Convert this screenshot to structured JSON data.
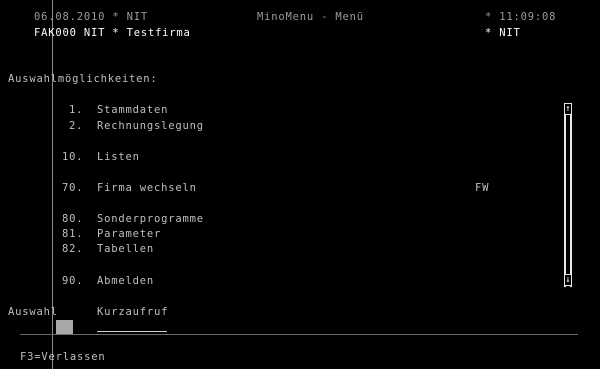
{
  "header": {
    "date_line": "06.08.2010 * NIT",
    "title": "MinoMenu - Menü",
    "time": "* 11:09:08",
    "company_line": "FAK000 NIT * Testfirma",
    "user": "* NIT"
  },
  "section_title": "Auswahlmöglichkeiten:",
  "menu": [
    {
      "num": "1.",
      "label": "Stammdaten",
      "shortcut": ""
    },
    {
      "num": "2.",
      "label": "Rechnungslegung",
      "shortcut": ""
    },
    {
      "num": "10.",
      "label": "Listen",
      "shortcut": ""
    },
    {
      "num": "70.",
      "label": "Firma wechseln",
      "shortcut": "FW"
    },
    {
      "num": "80.",
      "label": "Sonderprogramme",
      "shortcut": ""
    },
    {
      "num": "81.",
      "label": "Parameter",
      "shortcut": ""
    },
    {
      "num": "82.",
      "label": "Tabellen",
      "shortcut": ""
    },
    {
      "num": "90.",
      "label": "Abmelden",
      "shortcut": ""
    }
  ],
  "input": {
    "selection_label": "Auswahl",
    "shortcut_label": "Kurzaufruf",
    "selection_value": "",
    "shortcut_value": ""
  },
  "scrollbar": {
    "up_glyph": "↑",
    "down_glyph": "↓",
    "up_icon": "arrow-up-icon",
    "down_icon": "arrow-down-icon"
  },
  "footer": {
    "function_keys": "F3=Verlassen"
  },
  "colors": {
    "background": "#000000",
    "text": "#bfbfbf",
    "highlight": "#ffffff",
    "cursor": "#a8a8a8"
  }
}
